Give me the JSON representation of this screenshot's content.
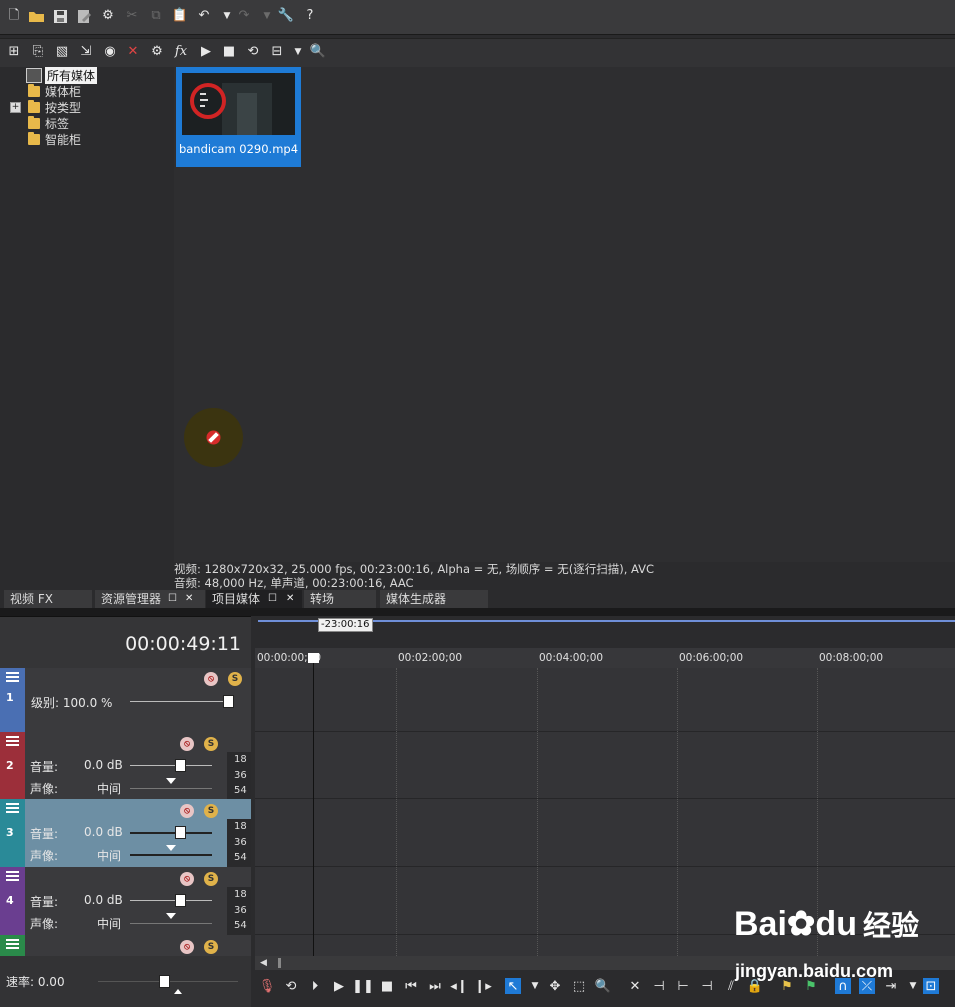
{
  "tree": {
    "root": "所有媒体",
    "items": [
      "媒体柜",
      "按类型",
      "标签",
      "智能柜"
    ]
  },
  "media": {
    "file_name": "bandicam 0290.mp4"
  },
  "status": {
    "video_line": "视频: 1280x720x32, 25.000 fps, 00:23:00:16, Alpha = 无, 场顺序 = 无(逐行扫描), AVC",
    "audio_line": "音频: 48,000 Hz, 单声道, 00:23:00:16, AAC"
  },
  "tabs": [
    {
      "label": "视频 FX",
      "active": false
    },
    {
      "label": "资源管理器",
      "active": false
    },
    {
      "label": "项目媒体",
      "active": true
    },
    {
      "label": "转场",
      "active": false
    },
    {
      "label": "媒体生成器",
      "active": false
    }
  ],
  "timeline": {
    "time_display": "00:00:49:11",
    "loop_label": "-23:00:16",
    "ruler_ticks": [
      "00:00:00;00",
      "00:02:00;00",
      "00:04:00;00",
      "00:06:00;00",
      "00:08:00;00"
    ]
  },
  "tracks": [
    {
      "number": "1",
      "type": "video",
      "level_label": "级别: 100.0 %",
      "level_percent": 100,
      "color": "#4a6fb3"
    },
    {
      "number": "2",
      "type": "audio",
      "volume_label": "音量:",
      "volume_value": "0.0 dB",
      "pan_label": "声像:",
      "pan_value": "中间",
      "color": "#9c2f3a",
      "meter": [
        "18",
        "36",
        "54"
      ]
    },
    {
      "number": "3",
      "type": "audio",
      "volume_label": "音量:",
      "volume_value": "0.0 dB",
      "pan_label": "声像:",
      "pan_value": "中间",
      "color": "#2a8a98",
      "meter": [
        "18",
        "36",
        "54"
      ],
      "selected": true
    },
    {
      "number": "4",
      "type": "audio",
      "volume_label": "音量:",
      "volume_value": "0.0 dB",
      "pan_label": "声像:",
      "pan_value": "中间",
      "color": "#6a3e90",
      "meter": [
        "18",
        "36",
        "54"
      ]
    }
  ],
  "rate": {
    "label": "速率: 0.00"
  },
  "watermark": {
    "brand": "Bai",
    "brand2": "du",
    "cn": "经验",
    "url": "jingyan.baidu.com"
  },
  "colors": {
    "accent": "#1e7bd6",
    "loop_region": "#6f8fd8"
  }
}
